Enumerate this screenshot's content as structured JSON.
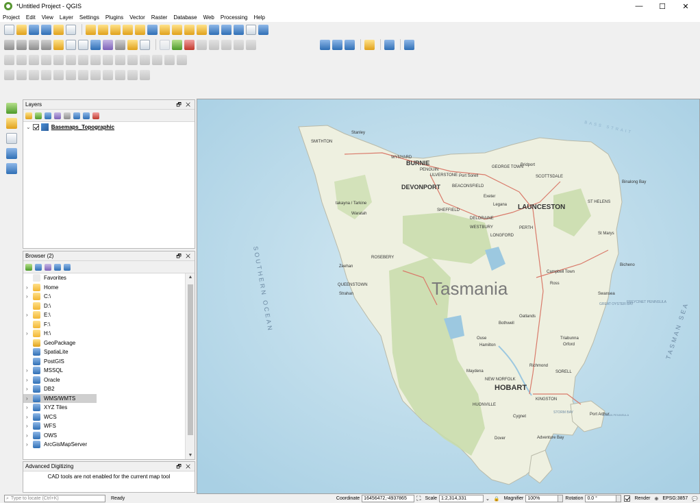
{
  "window": {
    "title": "*Untitled Project - QGIS",
    "minimize": "—",
    "maximize": "☐",
    "close": "✕"
  },
  "menu": [
    "Project",
    "Edit",
    "View",
    "Layer",
    "Settings",
    "Plugins",
    "Vector",
    "Raster",
    "Database",
    "Web",
    "Processing",
    "Help"
  ],
  "layers_panel": {
    "title": "Layers",
    "float": "🗗 ✕",
    "items": [
      {
        "name": "Basemaps_Topographic",
        "checked": true,
        "expanded": true
      }
    ]
  },
  "browser_panel": {
    "title": "Browser (2)",
    "float": "🗗 ✕",
    "items": [
      "Favorites",
      "Home",
      "C:\\",
      "D:\\",
      "E:\\",
      "F:\\",
      "H:\\",
      "GeoPackage",
      "SpatiaLite",
      "PostGIS",
      "MSSQL",
      "Oracle",
      "DB2",
      "WMS/WMTS",
      "XYZ Tiles",
      "WCS",
      "WFS",
      "OWS",
      "ArcGisMapServer"
    ],
    "selected": "WMS/WMTS"
  },
  "advanced_digitizing": {
    "title": "Advanced Digitizing",
    "float": "🗗 ✕",
    "message": "CAD tools are not enabled for the current map tool"
  },
  "status": {
    "locator_placeholder": "Type to locate (Ctrl+K)",
    "ready": "Ready",
    "coordinate_label": "Coordinate",
    "coordinate": "16456472,-4937865",
    "scale_label": "Scale",
    "scale": "1:2,314,331",
    "magnifier_label": "Magnifier",
    "magnifier": "100%",
    "rotation_label": "Rotation",
    "rotation": "0.0 °",
    "render_label": "Render",
    "crs": "EPSG:3857"
  },
  "map": {
    "title": "Tasmania",
    "ocean_southern": "SOUTHERN OCEAN",
    "tasman_sea": "TASMAN SEA",
    "bass_strait": "BASS STRAIT",
    "places": {
      "stanley": "Stanley",
      "smithton": "SMITHTON",
      "wynyard": "WYNYARD",
      "burnie": "BURNIE",
      "penguin": "PENGUIN",
      "ulverstone": "ULVERSTONE",
      "devonport": "DEVONPORT",
      "port_sorell": "Port Sorell",
      "beaconsfield": "BEACONSFIELD",
      "george_town": "GEORGE TOWN",
      "bridport": "Bridport",
      "scottsdale": "SCOTTSDALE",
      "binalong": "Binalong Bay",
      "exeter": "Exeter",
      "legana": "Legana",
      "launceston": "LAUNCESTON",
      "st_helens": "ST HELENS",
      "sheffield": "SHEFFIELD",
      "takayna": "takayna / Tarkine",
      "waratah": "Waratah",
      "deloraine": "DELORAINE",
      "westbury": "WESTBURY",
      "perth": "PERTH",
      "longford": "LONGFORD",
      "st_marys": "St Marys",
      "zeehan": "Zeehan",
      "rosebery": "ROSEBERY",
      "campbell_town": "Campbell Town",
      "bicheno": "Bicheno",
      "queenstown": "QUEENSTOWN",
      "strahan": "Strahan",
      "ross": "Ross",
      "swansea": "Swansea",
      "freycinet": "FREYCINET PENINSULA",
      "great_oyster": "GREAT OYSTER BAY",
      "oatlands": "Oatlands",
      "bothwell": "Bothwell",
      "ouse": "Ouse",
      "hamilton": "Hamilton",
      "triabunna": "Triabunna",
      "orford": "Orford",
      "richmond": "Richmond",
      "sorell": "SORELL",
      "maydena": "Maydena",
      "new_norfolk": "NEW NORFOLK",
      "hobart": "HOBART",
      "kingston": "KINGSTON",
      "huonville": "HUONVILLE",
      "cygnet": "Cygnet",
      "port_arthur": "Port Arthur",
      "tasman_peninsula": "TASMAN PENINSULA",
      "storm_bay": "STORM BAY",
      "dover": "Dover",
      "adventure_bay": "Adventure Bay"
    }
  },
  "colors": {
    "land": "#eef0e0",
    "park": "#c8dcaa",
    "water": "#b9d9ea",
    "road": "#d97a6a",
    "accent": "#589632"
  }
}
